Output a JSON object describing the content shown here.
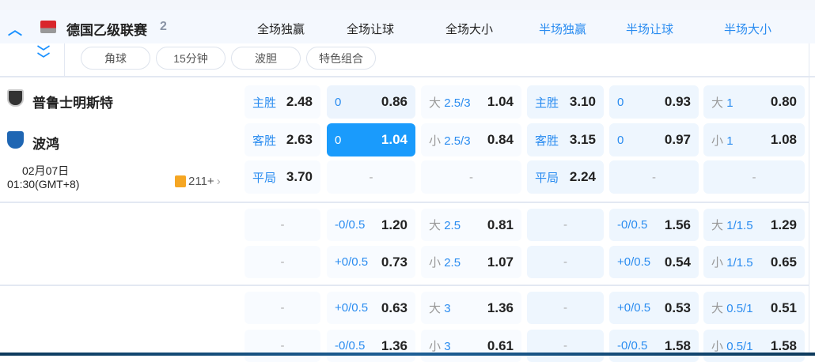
{
  "league": {
    "name": "德国乙级联赛",
    "count": "2"
  },
  "columns": [
    {
      "label": "全场独赢",
      "color": "#222222"
    },
    {
      "label": "全场让球",
      "color": "#222222"
    },
    {
      "label": "全场大小",
      "color": "#222222"
    },
    {
      "label": "半场独赢",
      "color": "#2a8cf0"
    },
    {
      "label": "半场让球",
      "color": "#2a8cf0"
    },
    {
      "label": "半场大小",
      "color": "#2a8cf0"
    }
  ],
  "filters": [
    "角球",
    "15分钟",
    "波胆",
    "特色组合"
  ],
  "match": {
    "home": "普鲁士明斯特",
    "away": "波鸿",
    "date": "02月07日",
    "time": "01:30(GMT+8)",
    "more": "211+"
  },
  "accent": "#1a9bfc",
  "sections": [
    {
      "rows": [
        [
          {
            "lab": "主胜",
            "odd": "2.48"
          },
          {
            "lab": "0",
            "odd": "0.86"
          },
          {
            "pre": "大",
            "lab": "2.5/3",
            "odd": "1.04"
          },
          {
            "lab": "主胜",
            "odd": "3.10"
          },
          {
            "lab": "0",
            "odd": "0.93"
          },
          {
            "pre": "大",
            "lab": "1",
            "odd": "0.80"
          }
        ],
        [
          {
            "lab": "客胜",
            "odd": "2.63"
          },
          {
            "lab": "0",
            "odd": "1.04",
            "selected": true
          },
          {
            "pre": "小",
            "lab": "2.5/3",
            "odd": "0.84"
          },
          {
            "lab": "客胜",
            "odd": "3.15"
          },
          {
            "lab": "0",
            "odd": "0.97"
          },
          {
            "pre": "小",
            "lab": "1",
            "odd": "1.08"
          }
        ],
        [
          {
            "lab": "平局",
            "odd": "3.70"
          },
          {
            "dash": "-"
          },
          {
            "dash": "-"
          },
          {
            "lab": "平局",
            "odd": "2.24"
          },
          {
            "dash": "-"
          },
          {
            "dash": "-"
          }
        ]
      ]
    },
    {
      "rows": [
        [
          {
            "dash": "-"
          },
          {
            "lab": "-0/0.5",
            "odd": "1.20"
          },
          {
            "pre": "大",
            "lab": "2.5",
            "odd": "0.81"
          },
          {
            "dash": "-"
          },
          {
            "lab": "-0/0.5",
            "odd": "1.56"
          },
          {
            "pre": "大",
            "lab": "1/1.5",
            "odd": "1.29"
          }
        ],
        [
          {
            "dash": "-"
          },
          {
            "lab": "+0/0.5",
            "odd": "0.73"
          },
          {
            "pre": "小",
            "lab": "2.5",
            "odd": "1.07"
          },
          {
            "dash": "-"
          },
          {
            "lab": "+0/0.5",
            "odd": "0.54"
          },
          {
            "pre": "小",
            "lab": "1/1.5",
            "odd": "0.65"
          }
        ]
      ]
    },
    {
      "rows": [
        [
          {
            "dash": "-"
          },
          {
            "lab": "+0/0.5",
            "odd": "0.63"
          },
          {
            "pre": "大",
            "lab": "3",
            "odd": "1.36"
          },
          {
            "dash": "-"
          },
          {
            "lab": "+0/0.5",
            "odd": "0.53"
          },
          {
            "pre": "大",
            "lab": "0.5/1",
            "odd": "0.51"
          }
        ],
        [
          {
            "dash": "-"
          },
          {
            "lab": "-0/0.5",
            "odd": "1.36"
          },
          {
            "pre": "小",
            "lab": "3",
            "odd": "0.61"
          },
          {
            "dash": "-"
          },
          {
            "lab": "-0/0.5",
            "odd": "1.58"
          },
          {
            "pre": "小",
            "lab": "0.5/1",
            "odd": "1.58"
          }
        ]
      ]
    }
  ]
}
